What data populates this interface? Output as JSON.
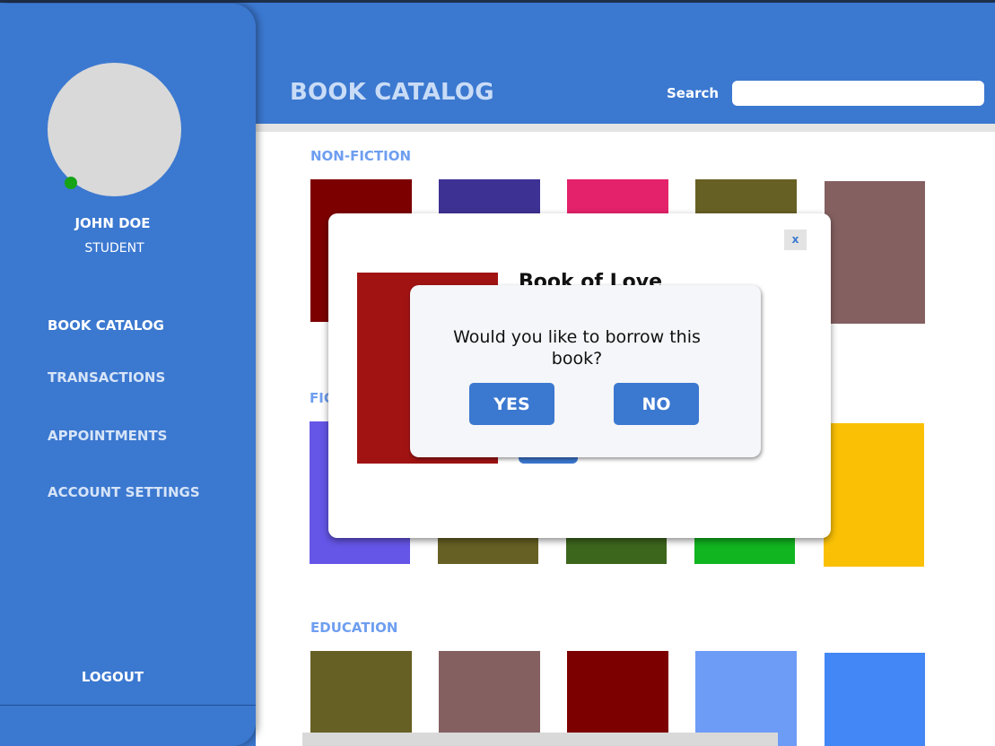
{
  "sidebar": {
    "user_name": "JOHN DOE",
    "user_role": "STUDENT",
    "nav": [
      "BOOK CATALOG",
      "TRANSACTIONS",
      "APPOINTMENTS",
      "ACCOUNT SETTINGS"
    ],
    "logout": "LOGOUT"
  },
  "header": {
    "title": "BOOK CATALOG",
    "search_label": "Search",
    "search_value": ""
  },
  "sections": [
    "NON-FICTION",
    "FIC",
    "EDUCATION"
  ],
  "detail": {
    "close_label": "x",
    "title": "Book of Love"
  },
  "confirm": {
    "message": "Would you like to borrow this book?",
    "yes": "YES",
    "no": "NO"
  },
  "colors": {
    "primary": "#3b78d0",
    "non_fiction_books": [
      "#7d0000",
      "#3d3193",
      "#e4226b",
      "#676024",
      "#856061"
    ],
    "fiction_books": [
      "#6656e8",
      "#676024",
      "#3d661d",
      "#11b51f",
      "#fac005"
    ],
    "education_books": [
      "#676024",
      "#856061",
      "#7d0000",
      "#6d9cf6",
      "#4287f5"
    ]
  }
}
